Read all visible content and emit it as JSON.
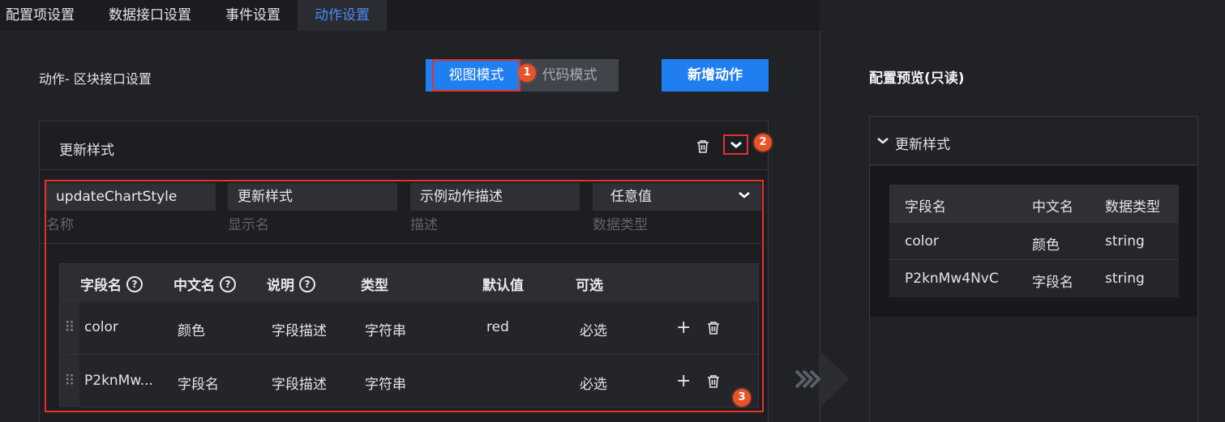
{
  "tabs": [
    "配置项设置",
    "数据接口设置",
    "事件设置",
    "动作设置"
  ],
  "section_title": "动作- 区块接口设置",
  "modes": {
    "view": "视图模式",
    "code": "代码模式"
  },
  "add_action": "新增动作",
  "markers": [
    "1",
    "2",
    "3"
  ],
  "action": {
    "title": "更新样式",
    "fields": [
      {
        "value": "updateChartStyle",
        "label": "名称"
      },
      {
        "value": "更新样式",
        "label": "显示名"
      },
      {
        "value": "示例动作描述",
        "label": "描述"
      },
      {
        "value": "任意值",
        "label": "数据类型"
      }
    ]
  },
  "table": {
    "headers": [
      "字段名",
      "中文名",
      "说明",
      "类型",
      "默认值",
      "可选"
    ],
    "rows": [
      {
        "name": "color",
        "cn": "颜色",
        "desc": "字段描述",
        "type": "字符串",
        "default": "red",
        "optional": "必选"
      },
      {
        "name": "P2knMw...",
        "cn": "字段名",
        "desc": "字段描述",
        "type": "字符串",
        "default": "",
        "optional": "必选"
      }
    ]
  },
  "preview": {
    "title": "配置预览(只读)",
    "action_title": "更新样式",
    "headers": [
      "字段名",
      "中文名",
      "数据类型"
    ],
    "rows": [
      [
        "color",
        "颜色",
        "string"
      ],
      [
        "P2knMw4NvC",
        "字段名",
        "string"
      ]
    ]
  }
}
